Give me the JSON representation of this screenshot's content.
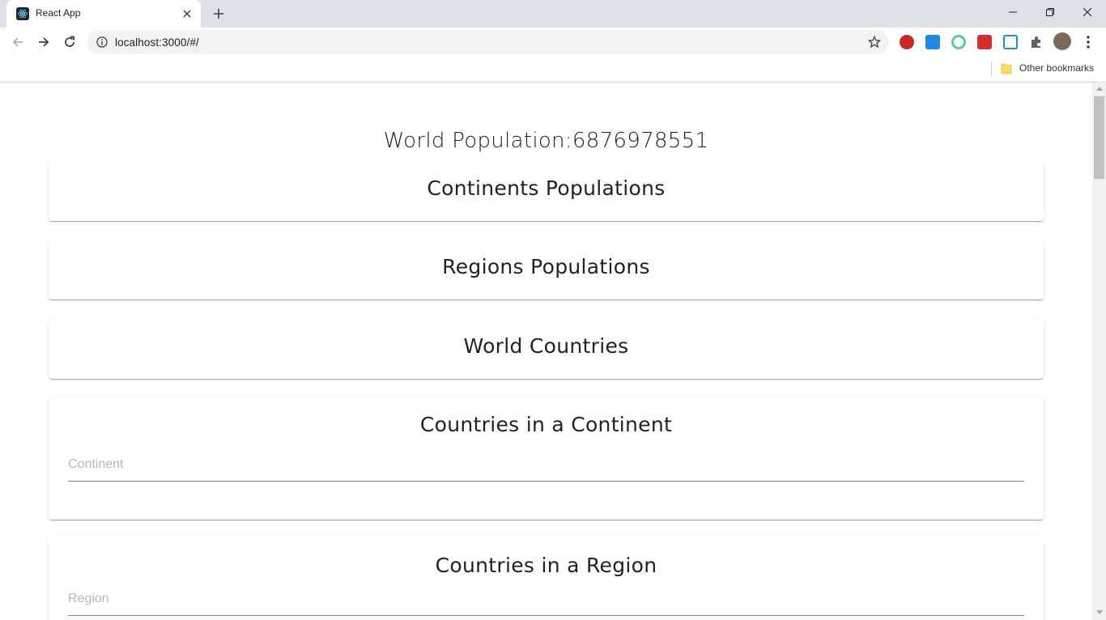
{
  "browser": {
    "tab_title": "React App",
    "url": "localhost:3000/#/",
    "bookmark_label": "Other bookmarks",
    "extension_icons": [
      "adblock-icon",
      "ext-pdf-icon",
      "ext-target-icon",
      "ext-red-icon",
      "ext-cast-icon",
      "puzzle-icon"
    ]
  },
  "page": {
    "world_population_label": "World Population:",
    "world_population_value": "6876978551",
    "cards": {
      "continents": "Continents Populations",
      "regions": "Regions Populations",
      "countries": "World Countries",
      "continent_countries": "Countries in a Continent",
      "region_countries": "Countries in a Region"
    },
    "fields": {
      "continent_placeholder": "Continent",
      "region_placeholder": "Region"
    }
  },
  "colors": {
    "tabstrip": "#dee1e6",
    "text": "#222222",
    "placeholder": "#b7b7b7"
  }
}
